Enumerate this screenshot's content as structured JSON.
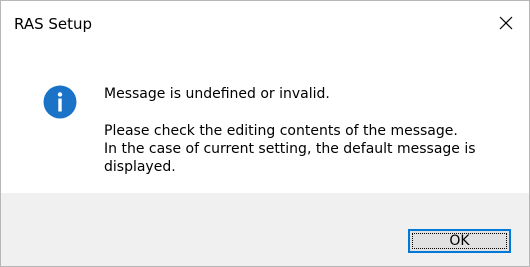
{
  "window": {
    "title": "RAS Setup",
    "close_icon": "close-icon"
  },
  "message": {
    "icon": "info-icon",
    "icon_color": "#1a73c7",
    "headline": "Message is undefined or invalid.",
    "body_lines": [
      "Please check the editing contents of the message.",
      "In the case of current setting, the default message is",
      "displayed."
    ]
  },
  "buttons": {
    "ok_label": "OK"
  }
}
